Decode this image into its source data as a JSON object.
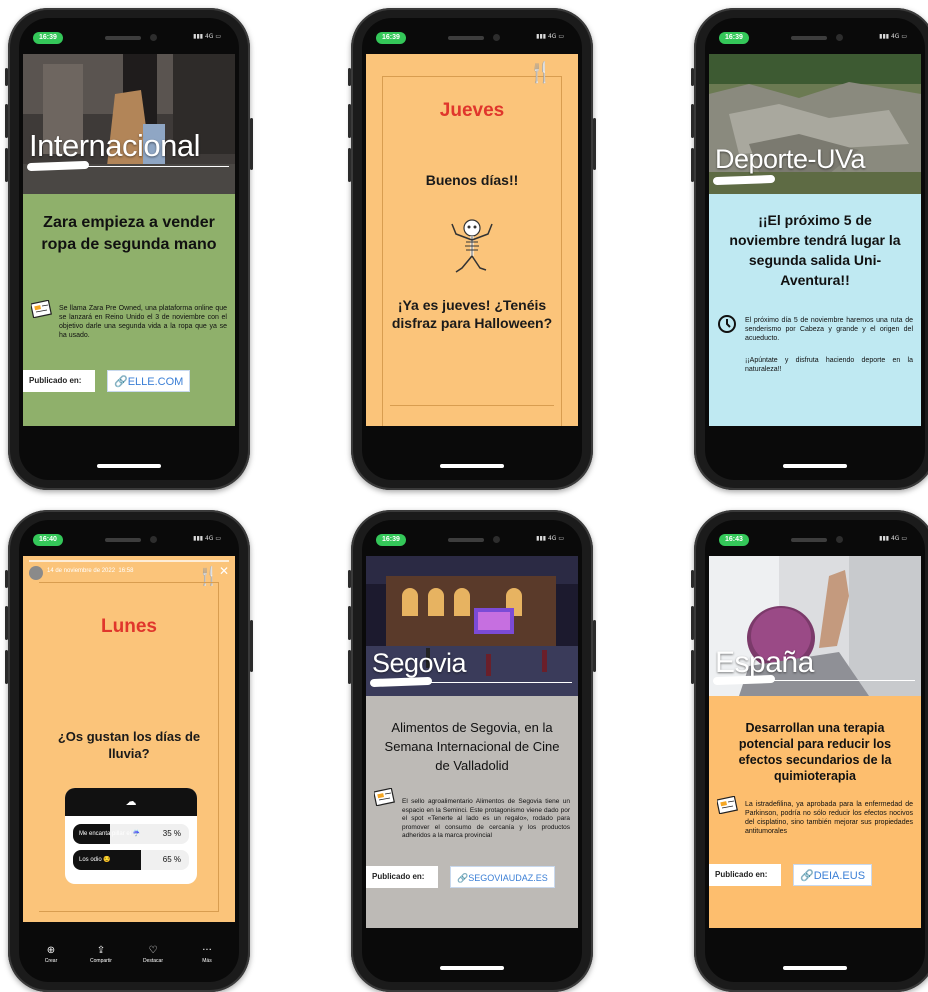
{
  "phones": [
    {
      "time": "16:39",
      "section": "Internacional",
      "headline": "Zara empieza a vender ropa de segunda mano",
      "body": "Se llama Zara Pre Owned, una plataforma online que se lanzará en Reino Unido el 3 de noviembre con el objetivo darle una segunda vida a la ropa que ya se ha usado.",
      "published_label": "Publicado en:",
      "source": "ELLE.COM"
    },
    {
      "time": "16:39",
      "day": "Jueves",
      "greeting": "Buenos días!!",
      "question": "¡Ya es jueves! ¿Tenéis disfraz para Halloween?"
    },
    {
      "time": "16:39",
      "section": "Deporte-UVa",
      "headline": "¡¡El próximo 5 de noviembre tendrá lugar la segunda salida Uni-Aventura!!",
      "body": "El próximo día 5 de noviembre haremos una ruta de senderismo por Cabeza y grande y el origen del acueducto.",
      "body2": "¡¡Apúntate y disfruta haciendo deporte en la naturaleza!!"
    },
    {
      "time": "16:40",
      "story_date": "14 de noviembre de 2022",
      "story_time": "16:58",
      "day": "Lunes",
      "question": "¿Os gustan los días de lluvia?",
      "poll": [
        {
          "label": "Me encanta pillar el ☔",
          "pct": "35 %",
          "value": 35
        },
        {
          "label": "Los odio 😒",
          "pct": "65 %",
          "value": 65
        }
      ],
      "tools": [
        "Crear",
        "Compartir",
        "Destacar",
        "Más"
      ]
    },
    {
      "time": "16:39",
      "section": "Segovia",
      "headline": "Alimentos de Segovia, en la Semana Internacional de Cine de Valladolid",
      "body": "El sello agroalimentario Alimentos de Segovia tiene un espacio en la Seminci. Este protagonismo viene dado por el spot «Tenerte al lado es un regalo», rodado para promover el consumo de cercanía y los productos adheridos a la marca provincial",
      "published_label": "Publicado en:",
      "source": "SEGOVIAUDAZ.ES"
    },
    {
      "time": "16:43",
      "section": "España",
      "headline": "Desarrollan una terapia potencial para reducir los efectos secundarios de la quimioterapia",
      "body": "La istradefilina, ya aprobada para la enfermedad de Parkinson, podría no sólo reducir los efectos nocivos del cisplatino, sino también mejorar sus propiedades antitumorales",
      "published_label": "Publicado en:",
      "source": "DEIA.EUS"
    }
  ],
  "signal_text": "4G",
  "colors": {
    "green": "#8fb06b",
    "peach": "#fbc47a",
    "sky": "#bfe9f2",
    "gray": "#bdbab6",
    "orange": "#fdbe6e"
  }
}
